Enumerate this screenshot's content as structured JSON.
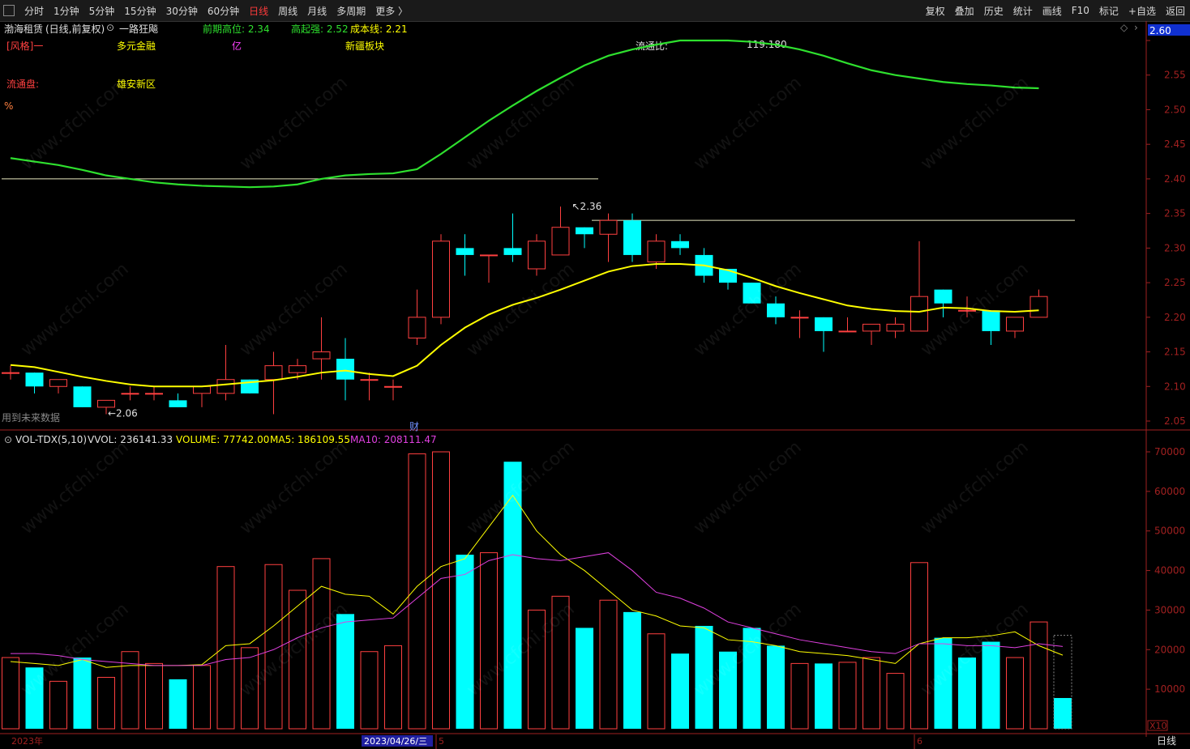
{
  "toolbar": {
    "periods": [
      {
        "label": "分时",
        "active": false
      },
      {
        "label": "1分钟",
        "active": false
      },
      {
        "label": "5分钟",
        "active": false
      },
      {
        "label": "15分钟",
        "active": false
      },
      {
        "label": "30分钟",
        "active": false
      },
      {
        "label": "60分钟",
        "active": false
      },
      {
        "label": "日线",
        "active": true
      },
      {
        "label": "周线",
        "active": false
      },
      {
        "label": "月线",
        "active": false
      },
      {
        "label": "多周期",
        "active": false
      },
      {
        "label": "更多 〉",
        "active": false
      }
    ],
    "right_buttons": [
      "复权",
      "叠加",
      "历史",
      "统计",
      "画线",
      "F10",
      "标记",
      "+自选",
      "返回"
    ]
  },
  "header": {
    "stock_name": "渤海租赁",
    "chart_mode": "(日线,前复权)",
    "indicator_name": "一路狂飚",
    "prev_high": "前期高位: 2.34",
    "strong_start": "高起强: 2.52",
    "cost_line": "成本线: 2.21"
  },
  "info": {
    "style_label": "[风格]一",
    "concept1": "多元金融",
    "yi": "亿",
    "sector": "新疆板块",
    "float_ratio_label": "流通比:",
    "float_ratio_value": "119.180",
    "float_cap_label": "流通盘:",
    "concept2": "雄安新区",
    "pct": "%",
    "future_data": "用到未来数据",
    "cai_marker": "财"
  },
  "price_panel": {
    "current_price_tag": "2.60",
    "y_ticks": [
      "2.60",
      "2.55",
      "2.50",
      "2.45",
      "2.40",
      "2.35",
      "2.30",
      "2.25",
      "2.20",
      "2.15",
      "2.10",
      "2.05"
    ],
    "ylim": [
      2.05,
      2.6
    ],
    "high_annotation": "2.36",
    "low_annotation": "2.06"
  },
  "volume_panel": {
    "title": "VOL-TDX(5,10)",
    "vvol": "VVOL: 236141.33",
    "volume": "VOLUME: 77742.00",
    "ma5": "MA5: 186109.55",
    "ma10": "MA10: 208111.47",
    "y_ticks": [
      "70000",
      "60000",
      "50000",
      "40000",
      "30000",
      "20000",
      "10000"
    ],
    "unit": "X10"
  },
  "x_axis": {
    "year_label": "2023年",
    "date_highlight": "2023/04/26/三",
    "month5": "5",
    "month6": "6",
    "period_label": "日线"
  },
  "colors": {
    "up": "#ff4040",
    "down": "#00ffff",
    "ma_yellow": "#ffff00",
    "ma_green": "#2ee02e",
    "ma10_magenta": "#e040e0",
    "axis_red": "#a02020"
  },
  "chart_data": {
    "type": "candlestick",
    "categories": [
      "1",
      "2",
      "3",
      "4",
      "5",
      "6",
      "7",
      "8",
      "9",
      "10",
      "11",
      "12",
      "13",
      "14",
      "15",
      "16",
      "17",
      "18",
      "19",
      "20",
      "21",
      "22",
      "23",
      "24",
      "25",
      "26",
      "27",
      "28",
      "29",
      "30",
      "31",
      "32",
      "33",
      "34",
      "35",
      "36",
      "37",
      "38",
      "39",
      "40",
      "41",
      "42",
      "43",
      "44"
    ],
    "ohlc": [
      [
        2.12,
        2.13,
        2.11,
        2.12
      ],
      [
        2.12,
        2.12,
        2.09,
        2.1
      ],
      [
        2.1,
        2.11,
        2.09,
        2.11
      ],
      [
        2.1,
        2.1,
        2.07,
        2.07
      ],
      [
        2.07,
        2.08,
        2.06,
        2.08
      ],
      [
        2.09,
        2.1,
        2.08,
        2.09
      ],
      [
        2.09,
        2.1,
        2.08,
        2.09
      ],
      [
        2.08,
        2.09,
        2.07,
        2.07
      ],
      [
        2.09,
        2.1,
        2.07,
        2.1
      ],
      [
        2.09,
        2.16,
        2.08,
        2.11
      ],
      [
        2.11,
        2.11,
        2.09,
        2.09
      ],
      [
        2.11,
        2.15,
        2.06,
        2.13
      ],
      [
        2.12,
        2.14,
        2.11,
        2.13
      ],
      [
        2.14,
        2.2,
        2.11,
        2.15
      ],
      [
        2.14,
        2.17,
        2.08,
        2.11
      ],
      [
        2.11,
        2.12,
        2.08,
        2.11
      ],
      [
        2.1,
        2.11,
        2.08,
        2.1
      ],
      [
        2.17,
        2.24,
        2.16,
        2.2
      ],
      [
        2.2,
        2.32,
        2.19,
        2.31
      ],
      [
        2.3,
        2.32,
        2.26,
        2.29
      ],
      [
        2.29,
        2.29,
        2.25,
        2.29
      ],
      [
        2.3,
        2.35,
        2.28,
        2.29
      ],
      [
        2.27,
        2.32,
        2.26,
        2.31
      ],
      [
        2.29,
        2.36,
        2.29,
        2.33
      ],
      [
        2.33,
        2.33,
        2.3,
        2.32
      ],
      [
        2.32,
        2.35,
        2.28,
        2.34
      ],
      [
        2.34,
        2.35,
        2.28,
        2.29
      ],
      [
        2.28,
        2.32,
        2.27,
        2.31
      ],
      [
        2.31,
        2.32,
        2.29,
        2.3
      ],
      [
        2.29,
        2.3,
        2.25,
        2.26
      ],
      [
        2.27,
        2.27,
        2.24,
        2.25
      ],
      [
        2.25,
        2.25,
        2.22,
        2.22
      ],
      [
        2.22,
        2.23,
        2.19,
        2.2
      ],
      [
        2.2,
        2.21,
        2.17,
        2.2
      ],
      [
        2.2,
        2.2,
        2.15,
        2.18
      ],
      [
        2.18,
        2.2,
        2.18,
        2.18
      ],
      [
        2.18,
        2.19,
        2.16,
        2.19
      ],
      [
        2.18,
        2.2,
        2.17,
        2.19
      ],
      [
        2.18,
        2.31,
        2.18,
        2.23
      ],
      [
        2.24,
        2.24,
        2.2,
        2.22
      ],
      [
        2.21,
        2.23,
        2.2,
        2.21
      ],
      [
        2.21,
        2.21,
        2.16,
        2.18
      ],
      [
        2.18,
        2.2,
        2.17,
        2.2
      ],
      [
        2.2,
        2.24,
        2.2,
        2.23
      ]
    ],
    "ma_yellow": [
      2.131,
      2.128,
      2.121,
      2.114,
      2.108,
      2.103,
      2.1,
      2.1,
      2.1,
      2.103,
      2.106,
      2.109,
      2.114,
      2.12,
      2.123,
      2.118,
      2.115,
      2.13,
      2.16,
      2.185,
      2.204,
      2.218,
      2.228,
      2.24,
      2.253,
      2.266,
      2.274,
      2.277,
      2.277,
      2.275,
      2.268,
      2.257,
      2.245,
      2.235,
      2.226,
      2.217,
      2.212,
      2.209,
      2.208,
      2.214,
      2.213,
      2.209,
      2.208,
      2.21
    ],
    "ma_green": [
      2.43,
      2.425,
      2.42,
      2.413,
      2.405,
      2.4,
      2.395,
      2.392,
      2.39,
      2.389,
      2.388,
      2.389,
      2.392,
      2.4,
      2.405,
      2.407,
      2.408,
      2.414,
      2.436,
      2.46,
      2.484,
      2.506,
      2.527,
      2.546,
      2.564,
      2.578,
      2.587,
      2.594,
      2.6,
      2.6,
      2.6,
      2.598,
      2.594,
      2.587,
      2.578,
      2.567,
      2.557,
      2.55,
      2.545,
      2.54,
      2.537,
      2.535,
      2.532,
      2.531
    ],
    "volume": [
      18000,
      15500,
      12000,
      18000,
      13000,
      19500,
      16500,
      12500,
      16000,
      41000,
      20500,
      41500,
      35000,
      43000,
      29000,
      19500,
      21000,
      69500,
      70000,
      44000,
      44500,
      67500,
      30000,
      33500,
      25500,
      32500,
      29500,
      24000,
      19000,
      26000,
      19500,
      25500,
      21000,
      16500,
      16500,
      16800,
      18000,
      14000,
      42000,
      23000,
      18000,
      22000,
      18000,
      27000,
      7774
    ],
    "volume_up": [
      true,
      false,
      true,
      false,
      true,
      true,
      true,
      false,
      true,
      true,
      true,
      true,
      true,
      true,
      false,
      true,
      true,
      true,
      true,
      false,
      true,
      false,
      true,
      true,
      false,
      true,
      false,
      true,
      false,
      false,
      false,
      false,
      false,
      true,
      false,
      true,
      true,
      true,
      true,
      false,
      false,
      false,
      true,
      true,
      false
    ],
    "ma5_vol": [
      17000,
      16500,
      16000,
      17500,
      15500,
      16000,
      16000,
      16000,
      16200,
      21000,
      21500,
      26000,
      31000,
      36000,
      34000,
      33500,
      29000,
      36000,
      41000,
      43000,
      51000,
      59000,
      50000,
      44000,
      40000,
      35000,
      30000,
      28500,
      26000,
      25500,
      22500,
      22000,
      21000,
      19500,
      19000,
      18500,
      17500,
      16500,
      21500,
      23000,
      23000,
      23500,
      24500,
      21000,
      18600
    ],
    "ma10_vol": [
      19000,
      19000,
      18500,
      17500,
      17000,
      16500,
      16000,
      16000,
      16000,
      17500,
      18000,
      20000,
      23000,
      25500,
      27000,
      27500,
      28000,
      33000,
      38000,
      39000,
      42500,
      44000,
      43000,
      42500,
      43500,
      44500,
      40000,
      34500,
      33000,
      30500,
      27000,
      25500,
      24000,
      22500,
      21500,
      20500,
      19500,
      19000,
      21500,
      21500,
      21000,
      21000,
      20500,
      21500,
      20800
    ]
  }
}
